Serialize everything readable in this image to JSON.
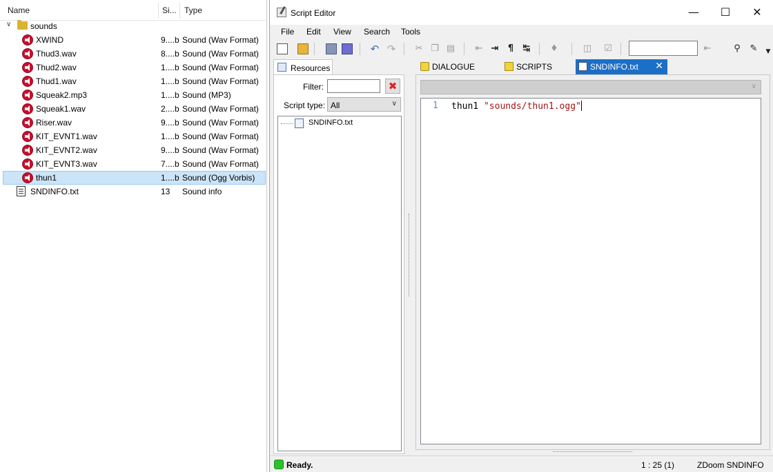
{
  "browser": {
    "headers": {
      "name": "Name",
      "size": "Si...",
      "type": "Type"
    },
    "folder": {
      "name": "sounds"
    },
    "entries": [
      {
        "name": "XWIND",
        "size": "9....b",
        "type": "Sound (Wav Format)",
        "kind": "sound"
      },
      {
        "name": "Thud3.wav",
        "size": "8....b",
        "type": "Sound (Wav Format)",
        "kind": "sound"
      },
      {
        "name": "Thud2.wav",
        "size": "1....b",
        "type": "Sound (Wav Format)",
        "kind": "sound"
      },
      {
        "name": "Thud1.wav",
        "size": "1....b",
        "type": "Sound (Wav Format)",
        "kind": "sound"
      },
      {
        "name": "Squeak2.mp3",
        "size": "1....b",
        "type": "Sound (MP3)",
        "kind": "sound"
      },
      {
        "name": "Squeak1.wav",
        "size": "2....b",
        "type": "Sound (Wav Format)",
        "kind": "sound"
      },
      {
        "name": "Riser.wav",
        "size": "9....b",
        "type": "Sound (Wav Format)",
        "kind": "sound"
      },
      {
        "name": "KIT_EVNT1.wav",
        "size": "1....b",
        "type": "Sound (Wav Format)",
        "kind": "sound"
      },
      {
        "name": "KIT_EVNT2.wav",
        "size": "9....b",
        "type": "Sound (Wav Format)",
        "kind": "sound"
      },
      {
        "name": "KIT_EVNT3.wav",
        "size": "7....b",
        "type": "Sound (Wav Format)",
        "kind": "sound"
      },
      {
        "name": "thun1",
        "size": "1....b",
        "type": "Sound (Ogg Vorbis)",
        "kind": "sound",
        "selected": true
      }
    ],
    "root_file": {
      "name": "SNDINFO.txt",
      "size": "13",
      "type": "Sound info"
    }
  },
  "editor": {
    "title": "Script Editor",
    "window_buttons": {
      "minimize": "—",
      "maximize": "☐",
      "close": "✕"
    },
    "menu": [
      "File",
      "Edit",
      "View",
      "Search",
      "Tools"
    ],
    "resources": {
      "tab_label": "Resources",
      "filter_label": "Filter:",
      "filter_value": "",
      "script_type_label": "Script type:",
      "script_type_value": "All",
      "tree_items": [
        "SNDINFO.txt"
      ]
    },
    "tabs": [
      {
        "label": "DIALOGUE",
        "active": false
      },
      {
        "label": "SCRIPTS",
        "active": false
      },
      {
        "label": "SNDINFO.txt",
        "active": true
      }
    ],
    "code_lines": [
      {
        "number": "1",
        "keyword": "thun1",
        "string": "\"sounds/thun1.ogg\""
      }
    ],
    "status": {
      "ready": "Ready.",
      "position": "1 : 25 (1)",
      "mode": "ZDoom SNDINFO"
    }
  },
  "colors": {
    "selection": "#cce4f7",
    "active_tab": "#1c6fc6",
    "sound_icon": "#c8102e",
    "string_literal": "#a31515",
    "ready_indicator": "#2bc22b"
  }
}
